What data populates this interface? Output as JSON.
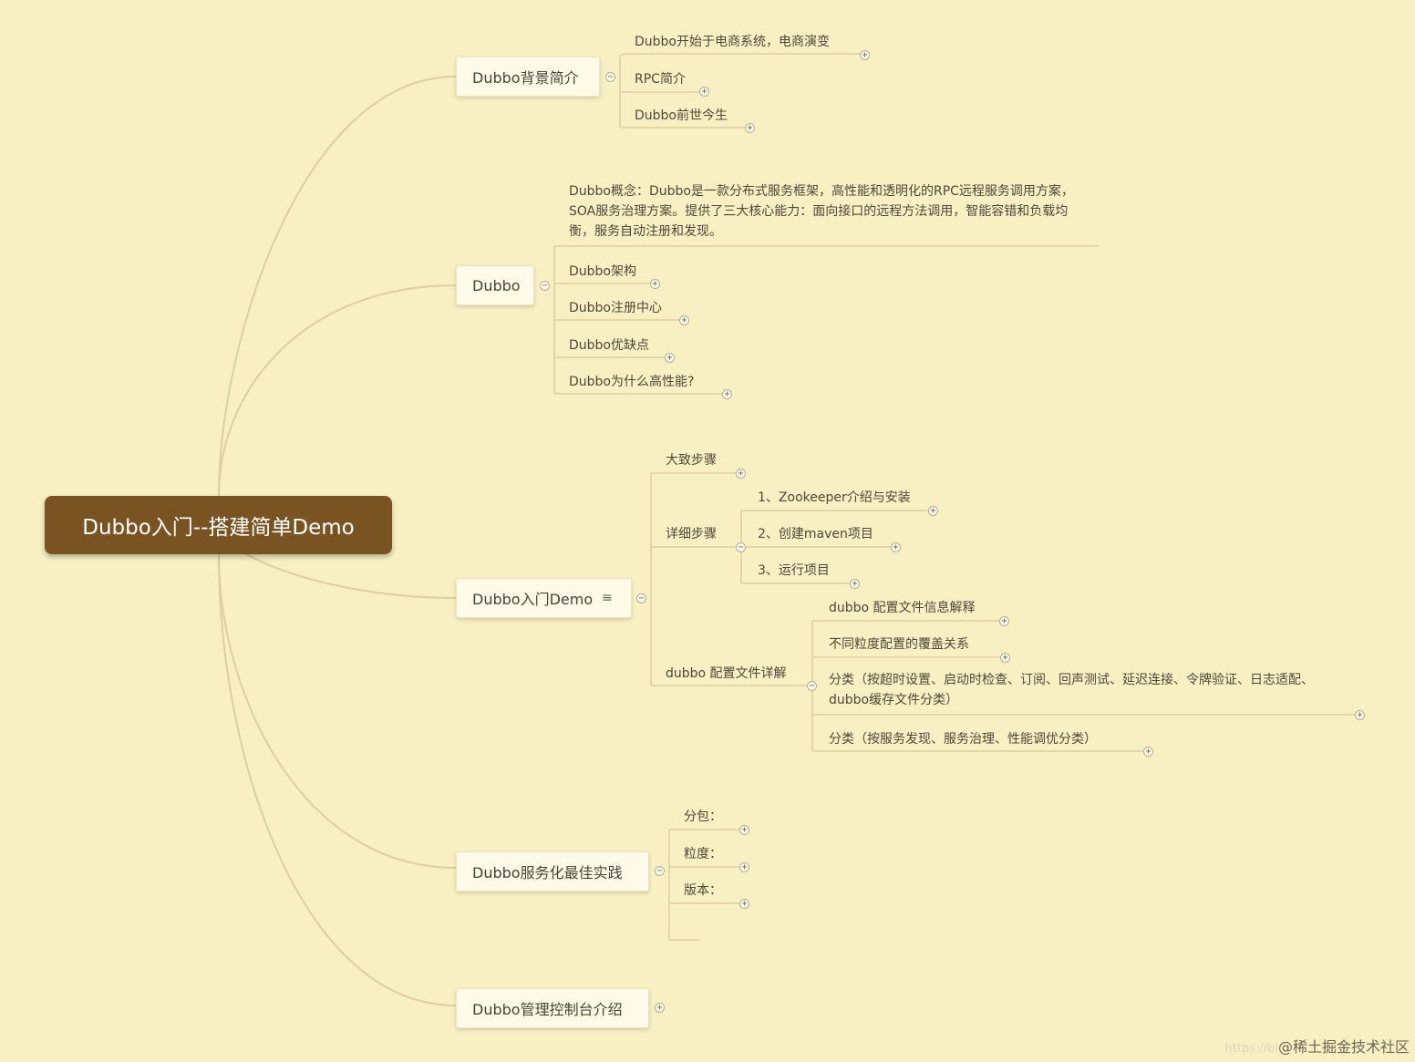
{
  "root": "Dubbo入门--搭建简单Demo",
  "branches": [
    {
      "label": "Dubbo背景简介",
      "children": [
        "Dubbo开始于电商系统，电商演变",
        "RPC简介",
        "Dubbo前世今生"
      ]
    },
    {
      "label": "Dubbo",
      "children": [
        "Dubbo概念：Dubbo是一款分布式服务框架，高性能和透明化的RPC远程服务调用方案，SOA服务治理方案。提供了三大核心能力：面向接口的远程方法调用，智能容错和负载均衡，服务自动注册和发现。",
        "Dubbo架构",
        "Dubbo注册中心",
        "Dubbo优缺点",
        "Dubbo为什么高性能?"
      ]
    },
    {
      "label": "Dubbo入门Demo",
      "menu": "≡",
      "children": [
        {
          "label": "大致步骤"
        },
        {
          "label": "详细步骤",
          "children": [
            "1、Zookeeper介绍与安装",
            "2、创建maven项目",
            "3、运行项目"
          ]
        },
        {
          "label": "dubbo 配置文件详解",
          "children": [
            "dubbo 配置文件信息解释",
            "不同粒度配置的覆盖关系",
            "分类（按超时设置、启动时检查、订阅、回声测试、延迟连接、令牌验证、日志适配、dubbo缓存文件分类）",
            "分类（按服务发现、服务治理、性能调优分类）"
          ]
        }
      ]
    },
    {
      "label": "Dubbo服务化最佳实践",
      "children": [
        "分包：",
        "粒度：",
        "版本："
      ]
    },
    {
      "label": "Dubbo管理控制台介绍"
    }
  ],
  "toggle": {
    "expanded": "−",
    "collapsed": "+"
  },
  "watermark": {
    "url": "https://bl",
    "brand": "@稀土掘金技术社区"
  },
  "colors": {
    "background": "#f8efc3",
    "root": "#7a5322",
    "line": "#dccfa2"
  }
}
